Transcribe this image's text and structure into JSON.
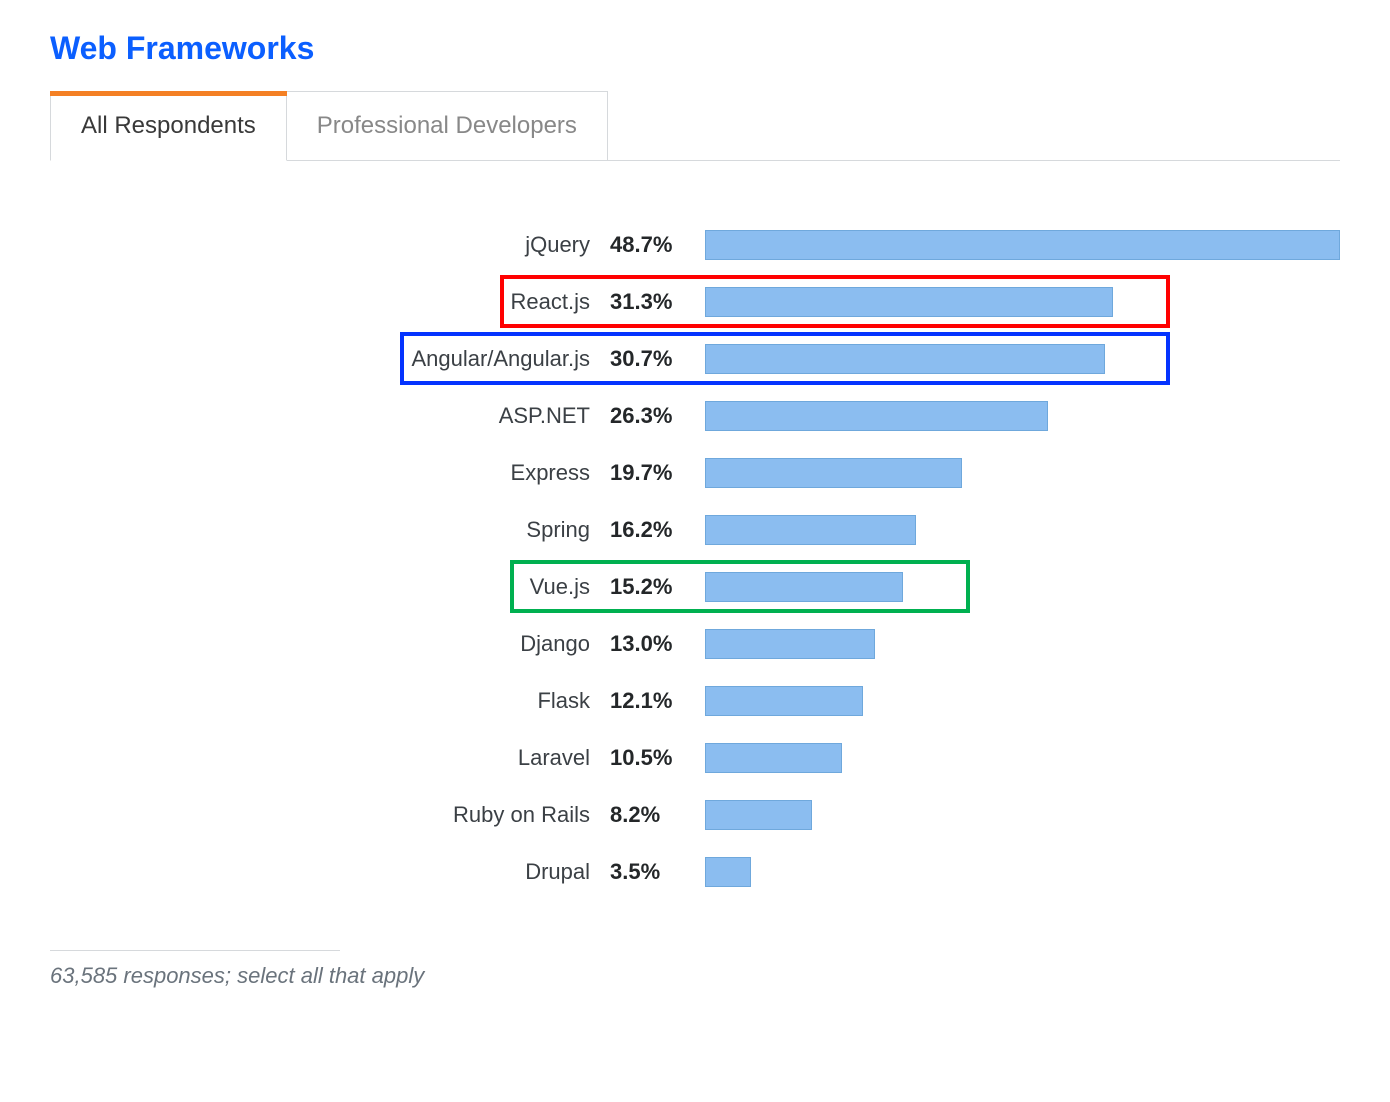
{
  "title": "Web Frameworks",
  "tabs": [
    {
      "label": "All Respondents",
      "active": true
    },
    {
      "label": "Professional Developers",
      "active": false
    }
  ],
  "footnote": "63,585 responses; select all that apply",
  "highlights": {
    "react": "#ff0000",
    "angular": "#0433ff",
    "vue": "#00b050"
  },
  "chart_data": {
    "type": "bar",
    "orientation": "horizontal",
    "title": "Web Frameworks",
    "xlabel": "",
    "ylabel": "",
    "max_value": 48.7,
    "categories": [
      "jQuery",
      "React.js",
      "Angular/Angular.js",
      "ASP.NET",
      "Express",
      "Spring",
      "Vue.js",
      "Django",
      "Flask",
      "Laravel",
      "Ruby on Rails",
      "Drupal"
    ],
    "values": [
      48.7,
      31.3,
      30.7,
      26.3,
      19.7,
      16.2,
      15.2,
      13.0,
      12.1,
      10.5,
      8.2,
      3.5
    ],
    "value_labels": [
      "48.7%",
      "31.3%",
      "30.7%",
      "26.3%",
      "19.7%",
      "16.2%",
      "15.2%",
      "13.0%",
      "12.1%",
      "10.5%",
      "8.2%",
      "3.5%"
    ],
    "bar_color": "#8bbdf0",
    "annotations": [
      {
        "category": "React.js",
        "box_color": "#ff0000"
      },
      {
        "category": "Angular/Angular.js",
        "box_color": "#0433ff"
      },
      {
        "category": "Vue.js",
        "box_color": "#00b050"
      }
    ]
  }
}
